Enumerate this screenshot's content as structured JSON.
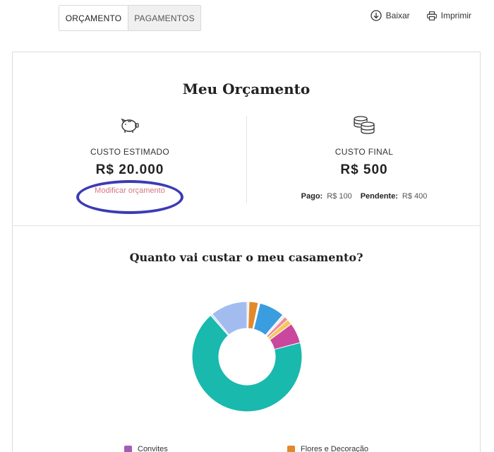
{
  "tabs": [
    {
      "label": "ORÇAMENTO",
      "active": true
    },
    {
      "label": "PAGAMENTOS",
      "active": false
    }
  ],
  "actions": {
    "download_label": "Baixar",
    "print_label": "Imprimir"
  },
  "budget": {
    "title": "Meu Orçamento",
    "estimated_label": "CUSTO ESTIMADO",
    "estimated_value": "R$ 20.000",
    "modify_link": "Modificar orçamento",
    "final_label": "CUSTO FINAL",
    "final_value": "R$ 500",
    "paid_label": "Pago:",
    "paid_value": "R$ 100",
    "pending_label": "Pendente:",
    "pending_value": "R$ 400"
  },
  "icons": {
    "estimated": "piggy-bank-icon",
    "final": "coins-icon",
    "download": "download-icon",
    "print": "printer-icon"
  },
  "colors": {
    "link": "#d4777f",
    "annotation": "#3b3bb5"
  },
  "chart_title": "Quanto vai custar o meu casamento?",
  "chart_data": {
    "type": "pie",
    "donut": true,
    "segments": [
      {
        "value": 0.6,
        "color": "#e9e9e9"
      },
      {
        "value": 2.7,
        "color": "#e18a2c"
      },
      {
        "value": 0.5,
        "color": "#ffffff"
      },
      {
        "value": 7.5,
        "color": "#3a9ddf"
      },
      {
        "value": 0.8,
        "color": "#eeeeee"
      },
      {
        "value": 1.2,
        "color": "#f08aa0"
      },
      {
        "value": 1.6,
        "color": "#f5c85a"
      },
      {
        "value": 6.0,
        "color": "#c9479c"
      },
      {
        "value": 67.6,
        "color": "#19b9ad"
      },
      {
        "value": 0.6,
        "color": "#cfd9f0"
      },
      {
        "value": 10.9,
        "color": "#a3bcf0"
      }
    ],
    "legend": [
      {
        "name": "Convites",
        "color": "#a05fb5"
      },
      {
        "name": "Flores e Decoração",
        "color": "#e18a2c"
      }
    ]
  }
}
